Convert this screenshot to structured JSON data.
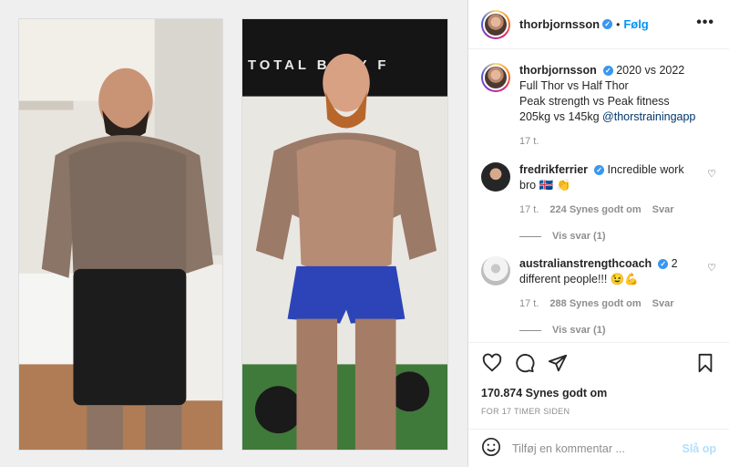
{
  "post": {
    "author": "thorbjornsson",
    "follow_label": "Følg",
    "more_icon": "more-horizontal-icon",
    "caption_lines": [
      "2020 vs 2022",
      "Full Thor vs Half Thor",
      "Peak strength vs Peak fitness"
    ],
    "caption_last": "205kg vs 145kg",
    "caption_mention": "@thorstrainingapp",
    "caption_time": "17 t."
  },
  "comments": [
    {
      "username": "fredrikferrier",
      "text": "Incredible work bro 🇮🇸 👏",
      "time": "17 t.",
      "likes": "224 Synes godt om",
      "reply": "Svar",
      "view_replies": "Vis svar (1)"
    },
    {
      "username": "australianstrengthcoach",
      "text": "2 different people!!! 😉💪",
      "time": "17 t.",
      "likes": "288 Synes godt om",
      "reply": "Svar",
      "view_replies": "Vis svar (1)"
    }
  ],
  "actions": {
    "likes_count": "170.874 Synes godt om",
    "time_ago": "FOR 17 TIMER SIDEN"
  },
  "compose": {
    "placeholder": "Tilføj en kommentar ...",
    "post_label": "Slå op"
  },
  "photos": {
    "right_banner_text": "TOTAL BODY F"
  }
}
